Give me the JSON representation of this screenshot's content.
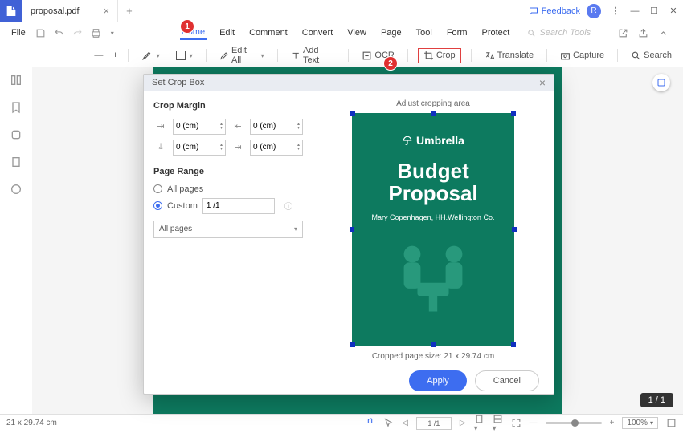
{
  "titlebar": {
    "tab_name": "proposal.pdf",
    "feedback": "Feedback",
    "avatar_initial": "R"
  },
  "menubar": {
    "file": "File",
    "tabs": [
      "Home",
      "Edit",
      "Comment",
      "Convert",
      "View",
      "Page",
      "Tool",
      "Form",
      "Protect"
    ],
    "active_tab": 0,
    "search_placeholder": "Search Tools"
  },
  "toolbar": {
    "edit_all": "Edit All",
    "add_text": "Add Text",
    "ocr": "OCR",
    "crop": "Crop",
    "translate": "Translate",
    "capture": "Capture",
    "search": "Search"
  },
  "badges": {
    "b1": "1",
    "b2": "2"
  },
  "dialog": {
    "title": "Set Crop Box",
    "crop_margin_heading": "Crop Margin",
    "margins": {
      "top": "0 (cm)",
      "left": "0 (cm)",
      "bottom": "0 (cm)",
      "right": "0 (cm)"
    },
    "page_range_heading": "Page Range",
    "all_pages_label": "All pages",
    "custom_label": "Custom",
    "custom_value": "1 /1",
    "select_value": "All pages",
    "adjust_label": "Adjust cropping area",
    "brand": "Umbrella",
    "doc_title_l1": "Budget",
    "doc_title_l2": "Proposal",
    "subtitle": "Mary Copenhagen, HH.Wellington Co.",
    "cropped_size": "Cropped page size: 21 x 29.74 cm",
    "apply": "Apply",
    "cancel": "Cancel"
  },
  "page_indicator": "1 / 1",
  "statusbar": {
    "dims": "21 x 29.74 cm",
    "page": "1 /1",
    "zoom": "100%"
  }
}
